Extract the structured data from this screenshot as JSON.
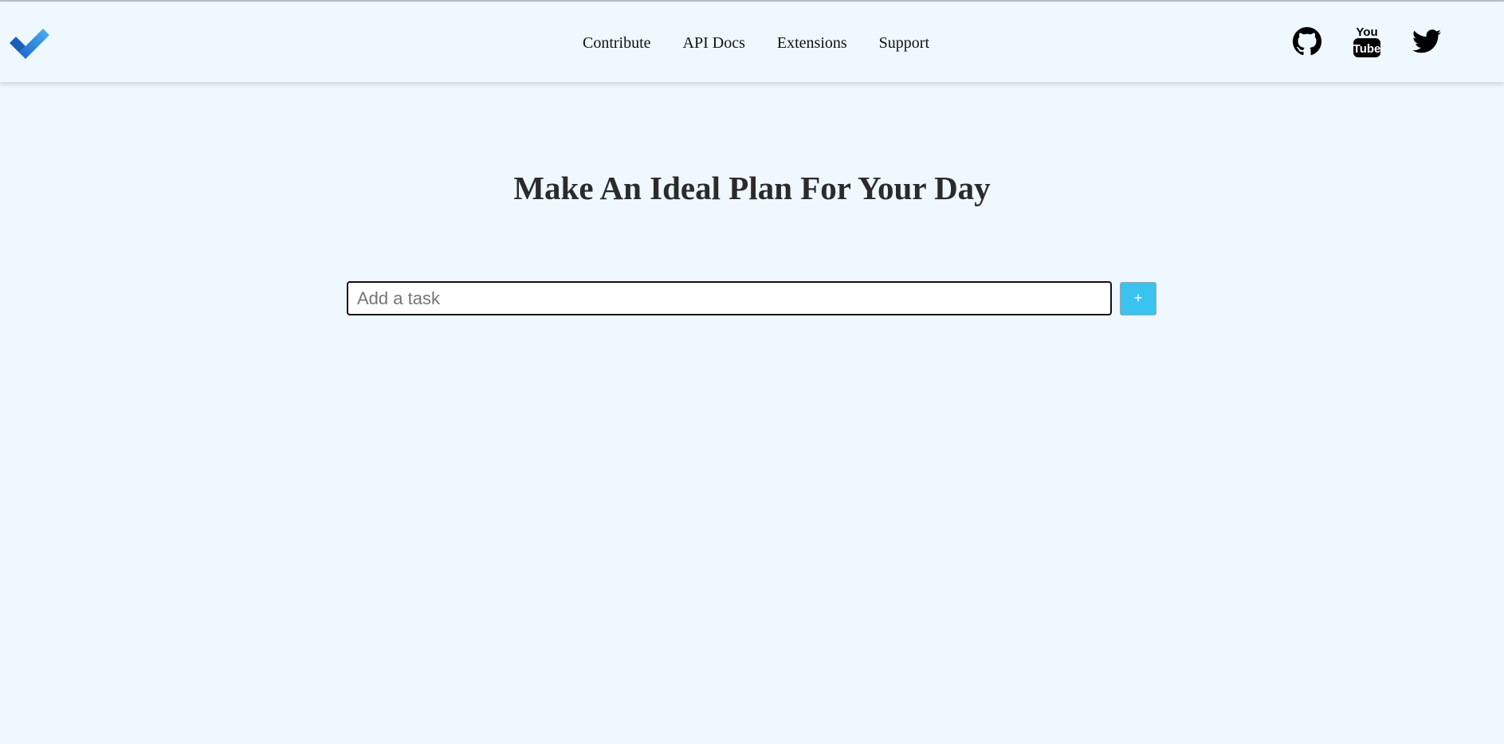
{
  "navbar": {
    "logo_icon": "checkmark-logo-icon",
    "links": [
      {
        "label": "Contribute"
      },
      {
        "label": "API Docs"
      },
      {
        "label": "Extensions"
      },
      {
        "label": "Support"
      }
    ],
    "social": [
      {
        "icon": "github-icon"
      },
      {
        "icon": "youtube-icon"
      },
      {
        "icon": "twitter-icon"
      }
    ]
  },
  "main": {
    "headline": "Make An Ideal Plan For Your Day",
    "task_input": {
      "value": "",
      "placeholder": "Add a task"
    },
    "add_button_label": "+"
  },
  "colors": {
    "background": "#eff8ff",
    "accent": "#3ac3ee",
    "logo_dark": "#1a5fb4",
    "logo_light": "#3d9be9"
  }
}
